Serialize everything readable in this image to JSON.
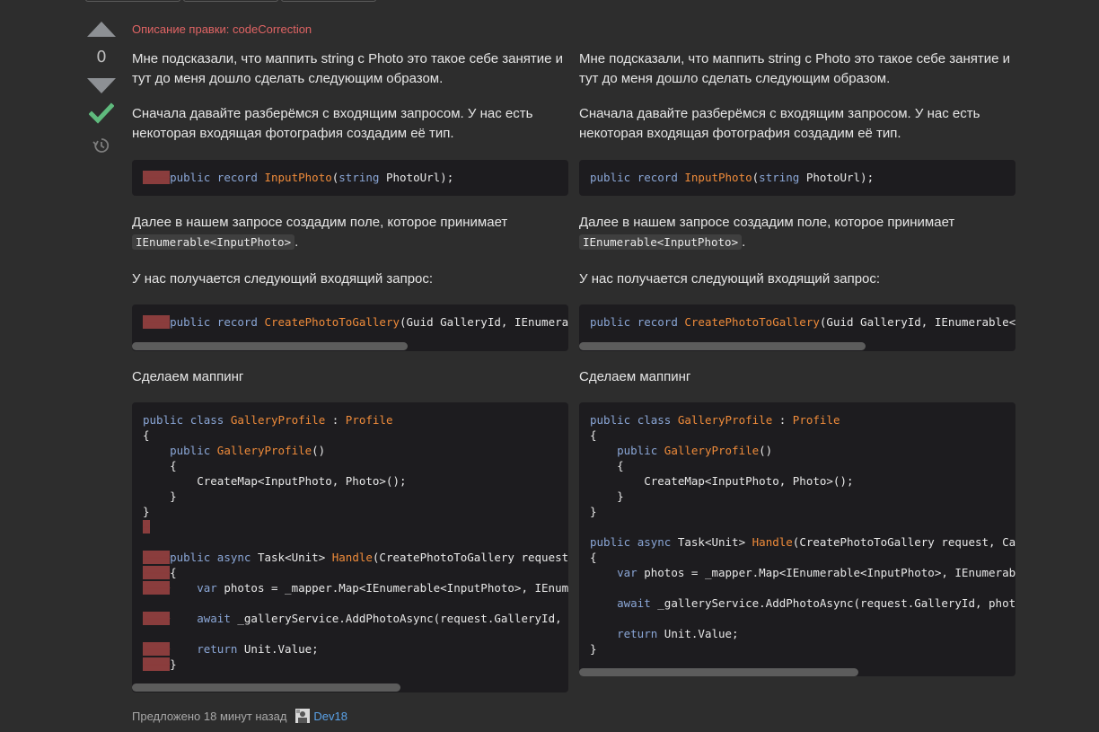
{
  "vote": {
    "count": "0"
  },
  "edit": {
    "description": "Описание правки: codeCorrection"
  },
  "left": {
    "p1": "Мне подсказали, что маппить string с Photo это такое себе занятие и тут до меня дошло сделать следующим образом.",
    "p2": "Сначала давайте разберёмся с входящим запросом. У нас есть некоторая входящая фотография создадим её тип.",
    "p3": "Далее в нашем запросе создадим поле, которое принимает",
    "p3_code": "IEnumerable<InputPhoto>",
    "p3_end": ".",
    "p4": "У нас получается следующий входящий запрос:",
    "p5": "Сделаем маппинг"
  },
  "right": {
    "p1": "Мне подсказали, что маппить string с Photo это такое себе занятие и тут до меня дошло сделать следующим образом.",
    "p2": "Сначала давайте разберёмся с входящим запросом. У нас есть некоторая входящая фотография создадим её тип.",
    "p3": "Далее в нашем запросе создадим поле, которое принимает",
    "p3_code": "IEnumerable<InputPhoto>",
    "p3_end": ".",
    "p4": "У нас получается следующий входящий запрос:",
    "p5": "Сделаем маппинг"
  },
  "footer": {
    "suggested": "Предложено 18 минут назад",
    "user": "Dev18"
  },
  "colors": {
    "background": "#2d2d2d",
    "code_bg": "#1d1c1f",
    "keyword": "#8aa6d6",
    "function": "#ef8b3a",
    "deleted": "#8a3d3d",
    "link": "#5aa2e8",
    "edit_label": "#e06464"
  },
  "icons": [
    "upvote-icon",
    "downvote-icon",
    "accepted-check-icon",
    "history-icon",
    "user-avatar-icon"
  ]
}
